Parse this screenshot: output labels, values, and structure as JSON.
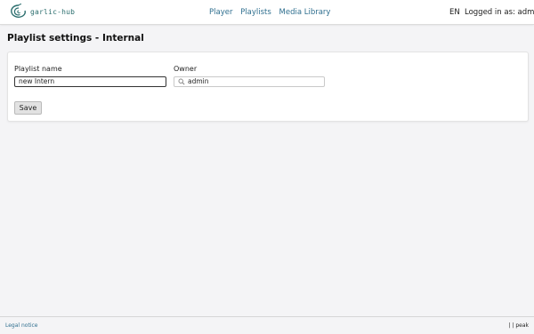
{
  "header": {
    "logo_text": "garlic-hub",
    "nav": [
      "Player",
      "Playlists",
      "Media Library"
    ],
    "language": "EN",
    "user": "Logged in as: admin"
  },
  "page": {
    "title": "Playlist settings - Internal"
  },
  "form": {
    "playlist_name_label": "Playlist name",
    "playlist_name_value": "new Intern",
    "owner_label": "Owner",
    "owner_value": "admin",
    "save_label": "Save"
  },
  "footer": {
    "legal": "Legal notice",
    "right": "| | peak"
  },
  "colors": {
    "accent": "#2f6f8f",
    "logo": "#2b6e6e",
    "background": "#f4f4f6"
  }
}
